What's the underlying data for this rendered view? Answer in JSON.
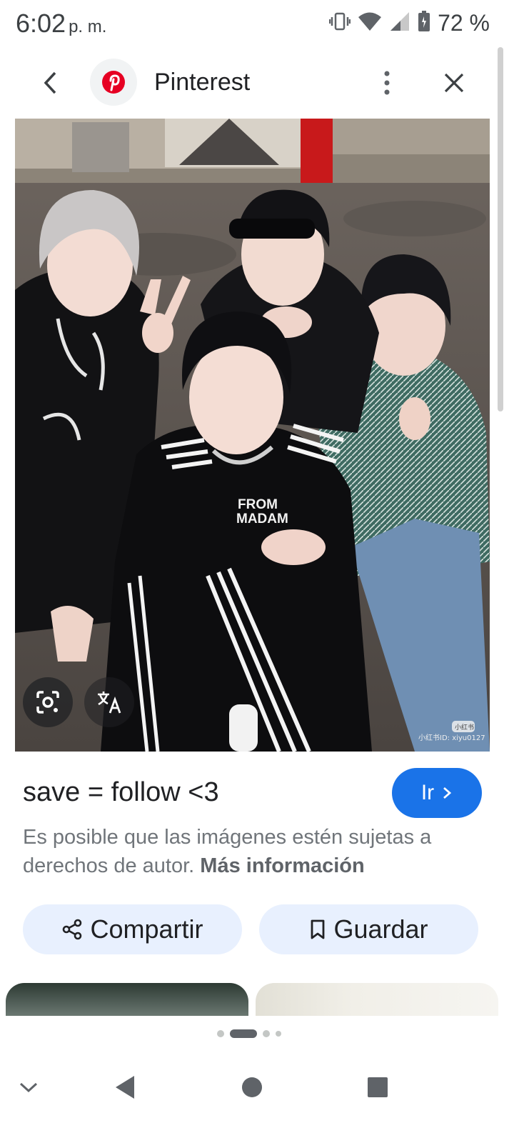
{
  "status_bar": {
    "time": "6:02",
    "ampm": "p. m.",
    "battery": "72 %"
  },
  "topbar": {
    "site_name": "Pinterest"
  },
  "image": {
    "shirt_text_1": "FROM",
    "shirt_text_2": "MADAM",
    "watermark_1": "小红书",
    "watermark_2": "小红书ID: xiyu0127"
  },
  "info": {
    "title": "save = follow <3",
    "go_label": "Ir",
    "copyright": "Es posible que las imágenes estén sujetas a derechos de autor.",
    "more_info": "Más información"
  },
  "actions": {
    "share_label": "Compartir",
    "save_label": "Guardar"
  },
  "carousel": {
    "page_count": 4,
    "active_index": 1
  }
}
